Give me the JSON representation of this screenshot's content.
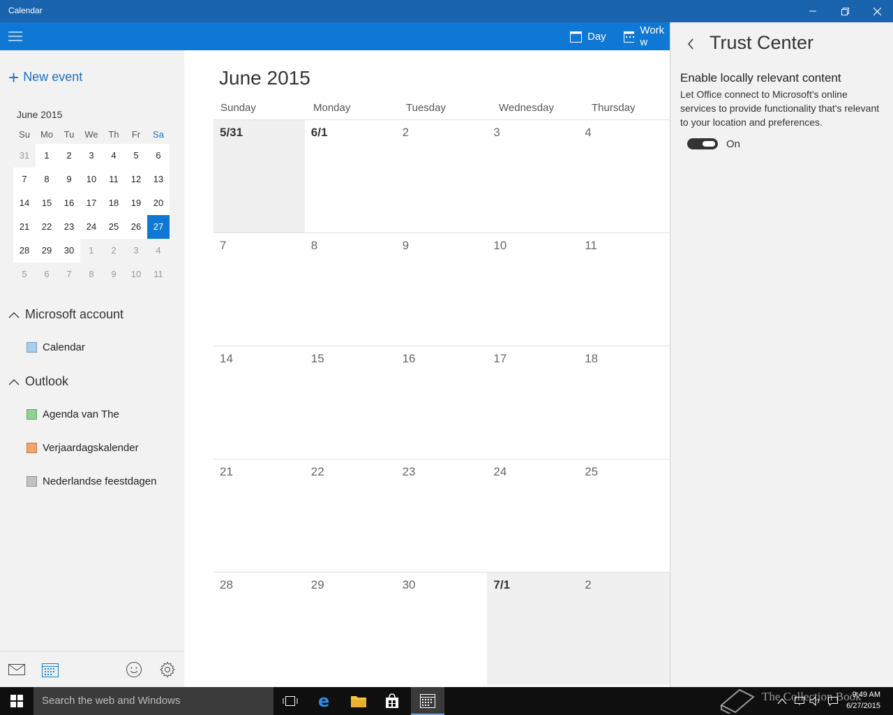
{
  "window": {
    "title": "Calendar",
    "colors": {
      "titlebar": "#1a63ad",
      "accent": "#0f78d4"
    }
  },
  "toolbar": {
    "day_label": "Day",
    "workweek_label": "Work w"
  },
  "sidebar": {
    "new_event_label": "New event",
    "mini_calendar": {
      "title": "June 2015",
      "weekdays": [
        "Su",
        "Mo",
        "Tu",
        "We",
        "Th",
        "Fr",
        "Sa"
      ],
      "weeks": [
        [
          "31",
          "1",
          "2",
          "3",
          "4",
          "5",
          "6"
        ],
        [
          "7",
          "8",
          "9",
          "10",
          "11",
          "12",
          "13"
        ],
        [
          "14",
          "15",
          "16",
          "17",
          "18",
          "19",
          "20"
        ],
        [
          "21",
          "22",
          "23",
          "24",
          "25",
          "26",
          "27"
        ],
        [
          "28",
          "29",
          "30",
          "1",
          "2",
          "3",
          "4"
        ],
        [
          "5",
          "6",
          "7",
          "8",
          "9",
          "10",
          "11"
        ]
      ],
      "selected": "27"
    },
    "accounts": [
      {
        "name": "Microsoft account",
        "calendars": [
          {
            "name": "Calendar",
            "color": "#a8cdf0"
          }
        ]
      },
      {
        "name": "Outlook",
        "calendars": [
          {
            "name": "Agenda van The",
            "color": "#8fd18f"
          },
          {
            "name": "Verjaardagskalender",
            "color": "#f4a56a"
          },
          {
            "name": "Nederlandse feestdagen",
            "color": "#c2c2c2"
          }
        ]
      }
    ]
  },
  "month_view": {
    "title": "June 2015",
    "weekdays": [
      "Sunday",
      "Monday",
      "Tuesday",
      "Wednesday",
      "Thursday"
    ],
    "weeks": [
      [
        "5/31",
        "6/1",
        "2",
        "3",
        "4"
      ],
      [
        "7",
        "8",
        "9",
        "10",
        "11"
      ],
      [
        "14",
        "15",
        "16",
        "17",
        "18"
      ],
      [
        "21",
        "22",
        "23",
        "24",
        "25"
      ],
      [
        "28",
        "29",
        "30",
        "7/1",
        "2"
      ]
    ]
  },
  "trust_center": {
    "title": "Trust Center",
    "heading": "Enable locally relevant content",
    "description": "Let Office connect to Microsoft's online services to provide functionality that's relevant to your location and preferences.",
    "toggle_label": "On",
    "toggle_on": true
  },
  "taskbar": {
    "search_placeholder": "Search the web and Windows",
    "time": "9:49 AM",
    "date": "6/27/2015",
    "watermark": "The Collection Book"
  }
}
